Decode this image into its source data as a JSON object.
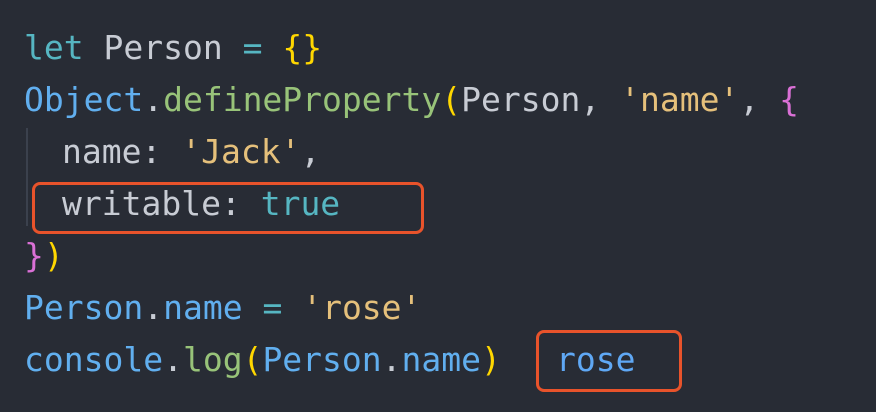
{
  "code": {
    "line1": {
      "kw": "let",
      "name": "Person",
      "op": "=",
      "braces": "{}"
    },
    "line2": {
      "obj": "Object",
      "dot": ".",
      "fn": "defineProperty",
      "paren_open": "(",
      "arg": "Person",
      "comma": ",",
      "str": "'name'",
      "comma2": ",",
      "brace_open": "{"
    },
    "line3": {
      "key": "name",
      "colon": ":",
      "str": "'Jack'",
      "comma": ","
    },
    "line4": {
      "key": "writable",
      "colon": ":",
      "bool": "true"
    },
    "line5": {
      "brace_close": "}",
      "paren_close": ")"
    },
    "line6": {
      "obj": "Person",
      "dot": ".",
      "prop": "name",
      "op": "=",
      "str": "'rose'"
    },
    "line7": {
      "obj": "console",
      "dot": ".",
      "fn": "log",
      "paren_open": "(",
      "arg_obj": "Person",
      "arg_dot": ".",
      "arg_prop": "name",
      "paren_close": ")"
    }
  },
  "output": {
    "value": "rose"
  },
  "colors": {
    "background": "#282c35",
    "highlight_border": "#e8532b"
  }
}
